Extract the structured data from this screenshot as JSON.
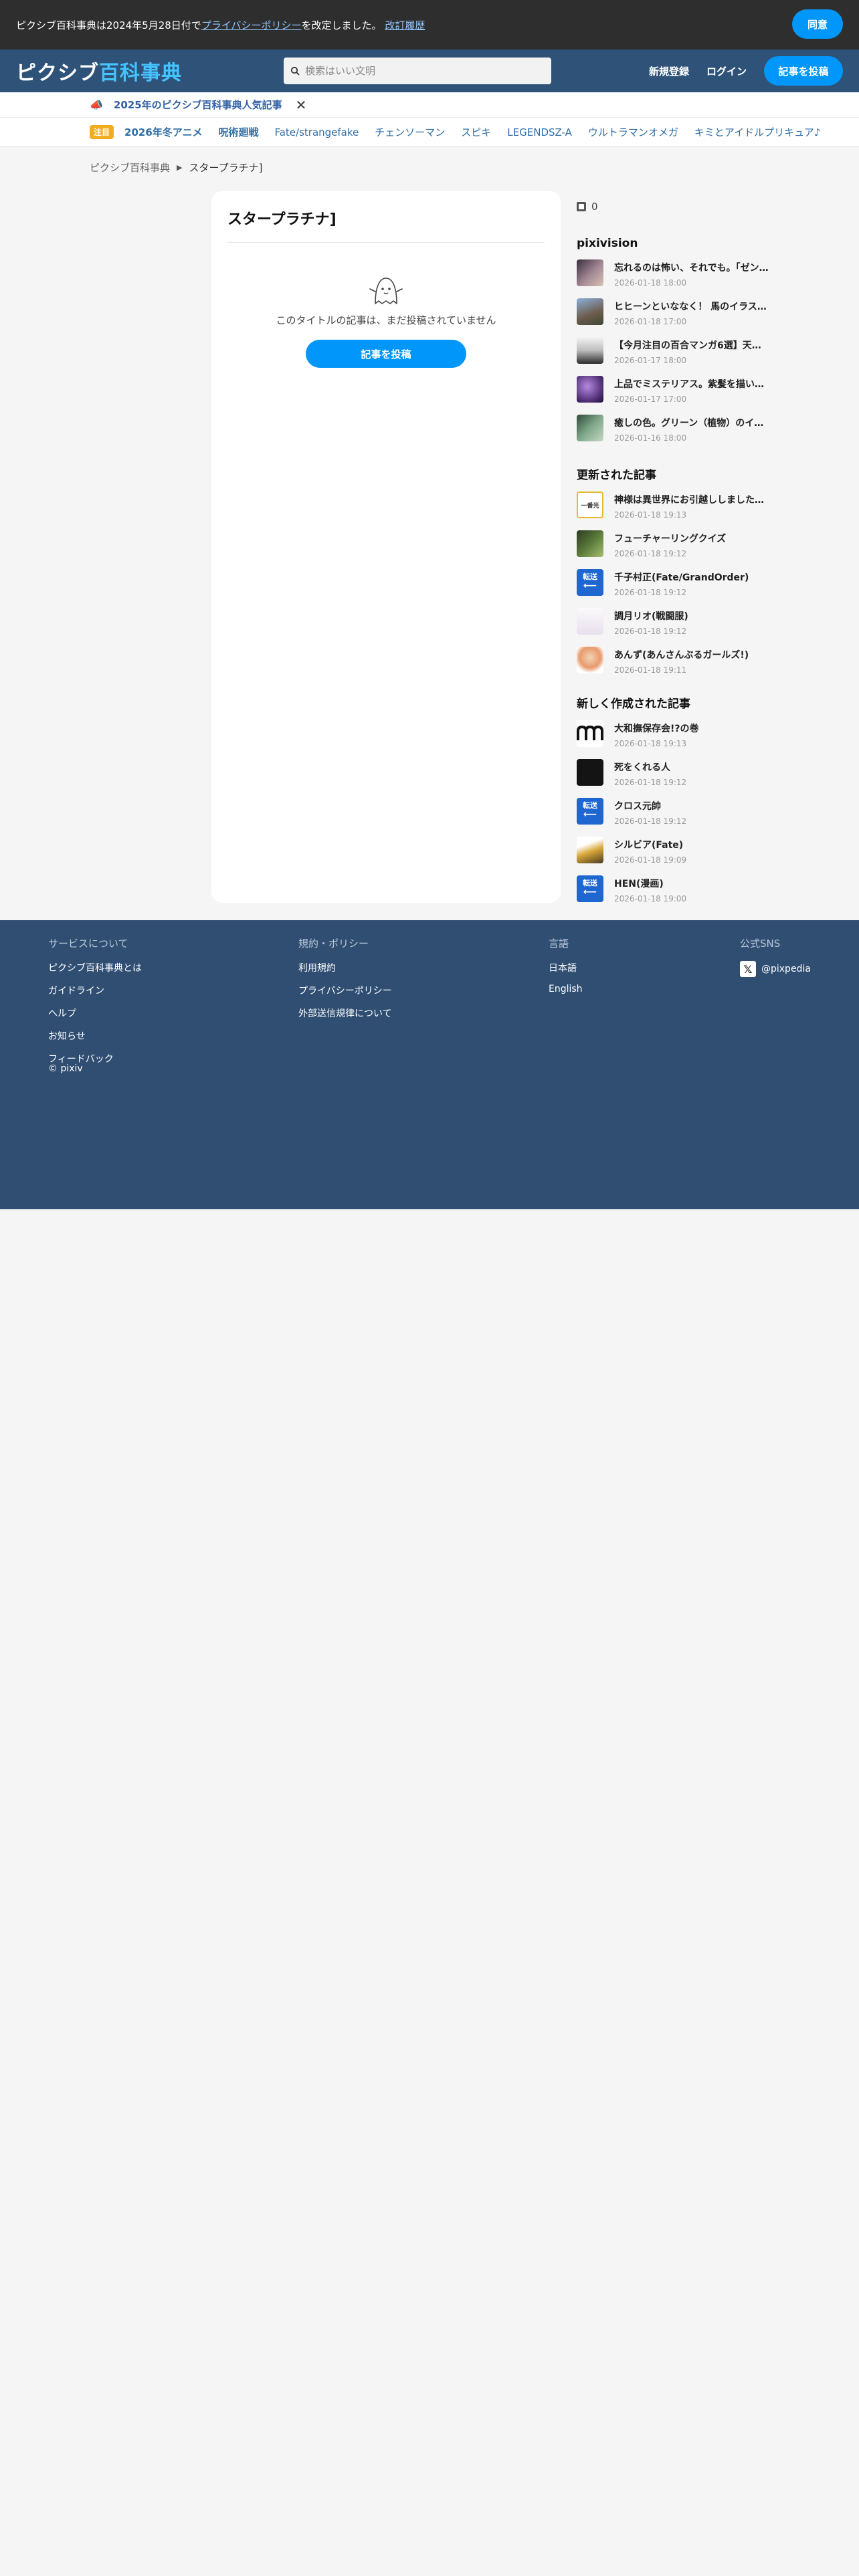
{
  "consent": {
    "text_before": "ピクシブ百科事典は2024年5月28日付で",
    "policy_link": "プライバシーポリシー",
    "text_after": "を改定しました。",
    "history_link": "改訂履歴",
    "agree_label": "同意"
  },
  "header": {
    "logo_a": "ピクシブ",
    "logo_b": "百科事典",
    "search_placeholder": "検索はいい文明",
    "signup": "新規登録",
    "login": "ログイン",
    "post": "記事を投稿"
  },
  "popular": {
    "label": "2025年のピクシブ百科事典人気記事",
    "close": "✕"
  },
  "tags": {
    "badge": "注目",
    "items": [
      "2026年冬アニメ",
      "呪術廻戦",
      "Fate/strangefake",
      "チェンソーマン",
      "スピキ",
      "LEGENDSZ-A",
      "ウルトラマンオメガ",
      "キミとアイドルプリキュア♪"
    ]
  },
  "breadcrumb": {
    "home": "ピクシブ百科事典",
    "current": "スタープラチナ]"
  },
  "article": {
    "title": "スタープラチナ]",
    "empty_message": "このタイトルの記事は、まだ投稿されていません",
    "write_button": "記事を投稿"
  },
  "sidebar": {
    "views": "0",
    "pixivision": {
      "title": "pixivision",
      "items": [
        {
          "title": "忘れるのは怖い、それでも。「ゼンゼ…",
          "date": "2026-01-18 18:00"
        },
        {
          "title": "ヒヒーンといななく！ 馬のイラスト…",
          "date": "2026-01-18 17:00"
        },
        {
          "title": "【今月注目の百合マンガ6選】天…",
          "date": "2026-01-17 18:00"
        },
        {
          "title": "上品でミステリアス。紫髪を描い…",
          "date": "2026-01-17 17:00"
        },
        {
          "title": "癒しの色。グリーン（植物）のイ…",
          "date": "2026-01-16 18:00"
        }
      ]
    },
    "updated": {
      "title": "更新された記事",
      "items": [
        {
          "title": "神様は異世界にお引越ししました…",
          "date": "2026-01-18 19:13"
        },
        {
          "title": "フューチャーリングクイズ",
          "date": "2026-01-18 19:12"
        },
        {
          "title": "千子村正(Fate/GrandOrder)",
          "date": "2026-01-18 19:12"
        },
        {
          "title": "調月リオ(戦闘服)",
          "date": "2026-01-18 19:12"
        },
        {
          "title": "あんず(あんさんぶるガールズ!)",
          "date": "2026-01-18 19:11"
        }
      ]
    },
    "created": {
      "title": "新しく作成された記事",
      "items": [
        {
          "title": "大和撫保存会!?の巻",
          "date": "2026-01-18 19:13"
        },
        {
          "title": "死をくれる人",
          "date": "2026-01-18 19:12"
        },
        {
          "title": "クロス元帥",
          "date": "2026-01-18 19:12"
        },
        {
          "title": "シルビア(Fate)",
          "date": "2026-01-18 19:09"
        },
        {
          "title": "HEN(漫画)",
          "date": "2026-01-18 19:00"
        }
      ]
    },
    "tenso_label": "転送",
    "brand_label": "一番光"
  },
  "footer": {
    "service": {
      "head": "サービスについて",
      "links": [
        "ピクシブ百科事典とは",
        "ガイドライン",
        "ヘルプ",
        "お知らせ",
        "フィードバック"
      ]
    },
    "policy": {
      "head": "規約・ポリシー",
      "links": [
        "利用規約",
        "プライバシーポリシー",
        "外部送信規律について"
      ]
    },
    "language": {
      "head": "言語",
      "links": [
        "日本語",
        "English"
      ]
    },
    "sns": {
      "head": "公式SNS",
      "account": "@pixpedia"
    },
    "copyright": "© pixiv"
  },
  "colors": {
    "accent": "#0096fa",
    "header": "#2f5378",
    "footer": "#2f4e72"
  }
}
